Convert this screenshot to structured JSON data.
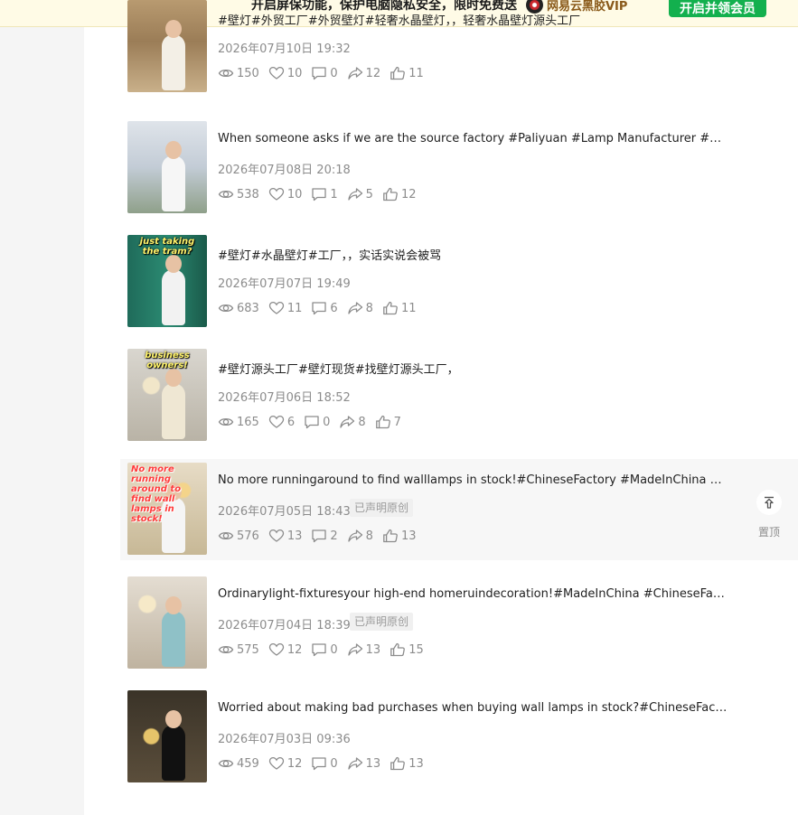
{
  "banner": {
    "text": "开启屏保功能，保护电脑隐私安全，限时免费送",
    "brand": "网易云黑胶VIP",
    "button_label": "开启并领会员"
  },
  "pin_label": "置顶",
  "videos": [
    {
      "title": "#壁灯#外贸工厂#外贸壁灯#轻奢水晶壁灯，，轻奢水晶壁灯源头工厂",
      "date": "2026年07月10日 19:32",
      "views": "150",
      "likes": "10",
      "comments": "0",
      "shares": "12",
      "thumbs": "11",
      "badge": "",
      "caption": ""
    },
    {
      "title": "When someone asks if we are the source factory #Paliyuan #Lamp Manufacturer #Source Factory",
      "date": "2026年07月08日 20:18",
      "views": "538",
      "likes": "10",
      "comments": "1",
      "shares": "5",
      "thumbs": "12",
      "badge": "",
      "caption": ""
    },
    {
      "title": "#壁灯#水晶壁灯#工厂，，实话实说会被骂",
      "date": "2026年07月07日 19:49",
      "views": "683",
      "likes": "11",
      "comments": "6",
      "shares": "8",
      "thumbs": "11",
      "badge": "",
      "caption": "just taking the tram?"
    },
    {
      "title": "#壁灯源头工厂#壁灯现货#找壁灯源头工厂，",
      "date": "2026年07月06日 18:52",
      "views": "165",
      "likes": "6",
      "comments": "0",
      "shares": "8",
      "thumbs": "7",
      "badge": "",
      "caption": "business owners!"
    },
    {
      "title": "No more runningaround to find walllamps in stock!#ChineseFactory #MadeInChina #WallLamps",
      "date": "2026年07月05日 18:43",
      "views": "576",
      "likes": "13",
      "comments": "2",
      "shares": "8",
      "thumbs": "13",
      "badge": "已声明原创",
      "caption": "No more running around to find wall lamps in stock!"
    },
    {
      "title": "Ordinarylight-fixturesyour high-end homeruindecoration!#MadeInChina #ChineseFactory #Lighting",
      "date": "2026年07月04日 18:39",
      "views": "575",
      "likes": "12",
      "comments": "0",
      "shares": "13",
      "thumbs": "15",
      "badge": "已声明原创",
      "caption": ""
    },
    {
      "title": "Worried about making bad purchases when buying wall lamps in stock?#ChineseFactory #MadeInChina",
      "date": "2026年07月03日 09:36",
      "views": "459",
      "likes": "12",
      "comments": "0",
      "shares": "13",
      "thumbs": "13",
      "badge": "",
      "caption": ""
    }
  ],
  "colors": {
    "accent_green": "#13b04e",
    "banner_bg": "#fffbe6",
    "meta_gray": "#8c8c8c"
  },
  "icons": [
    "eye-icon",
    "heart-icon",
    "comment-icon",
    "share-icon",
    "thumbs-up-icon",
    "pin-to-top-icon",
    "vinyl-disc-icon"
  ]
}
